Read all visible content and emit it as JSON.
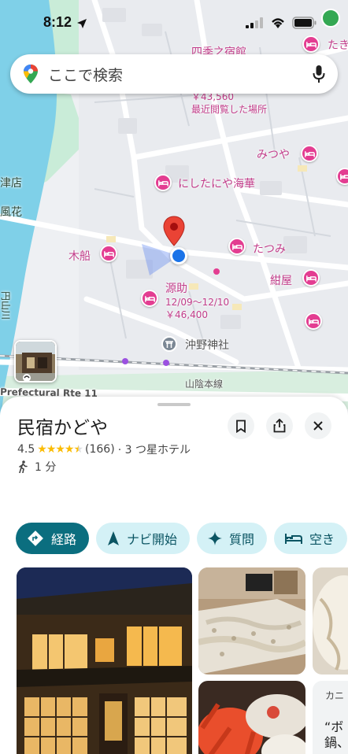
{
  "status_bar": {
    "time": "8:12"
  },
  "search": {
    "placeholder": "ここで検索"
  },
  "map": {
    "labels": {
      "shikinoyado": "四季之宿館",
      "price_top": "￥43,560",
      "recent": "最近閲覧した場所",
      "taki": "たき",
      "mitsuya": "みつや",
      "nishitaniya": "にしたにや海華",
      "tsuten": "津店",
      "fuka": "風花",
      "kibune": "木船",
      "tatsumi": "たつみ",
      "konya": "紺屋",
      "gensuke": "源助",
      "gensuke_dates": "12/09～12/10",
      "gensuke_price": "￥46,400",
      "okino_shrine": "沖野神社",
      "sanin_line": "山陰本線",
      "prefectural_route": "Prefectural Rte 11",
      "river": "円山川"
    }
  },
  "place": {
    "name": "民宿かどや",
    "rating": "4.5",
    "review_count": "(166)",
    "category": "· 3 つ星ホテル",
    "walk_time": "1 分"
  },
  "actions": {
    "directions": "経路",
    "navigate": "ナビ開始",
    "ask": "質問",
    "vacancy": "空き"
  },
  "photos": {
    "crab_caption": "カニ",
    "quote": "“ボ\n鍋、"
  },
  "colors": {
    "hotel_pin": "#e33d91",
    "primary_chip": "#0b6e7f",
    "secondary_chip": "#d4f1f6",
    "river": "#7fd0e8",
    "park": "#c9ecd8"
  }
}
